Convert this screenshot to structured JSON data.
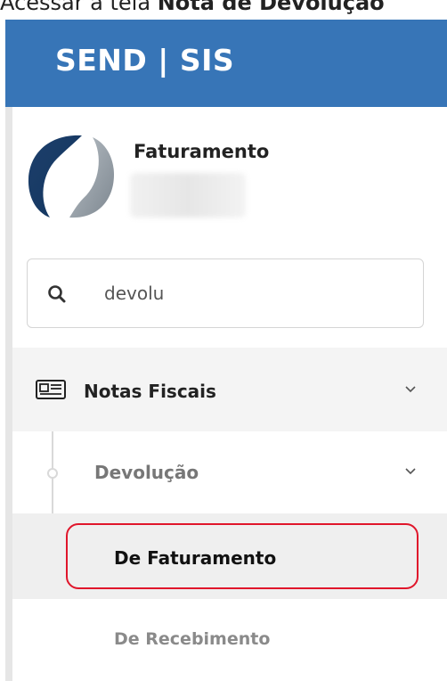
{
  "caption": {
    "prefix": "Acessar a tela ",
    "bold": "Nota de Devolução"
  },
  "header": {
    "brand": "SEND | SIS",
    "color": "#3775b7"
  },
  "profile": {
    "app_name": "Faturamento",
    "logo_icon": "sendsis-logo-icon"
  },
  "search": {
    "value": "devolu",
    "icon": "search-icon"
  },
  "menu": {
    "notas_fiscais": {
      "label": "Notas Fiscais",
      "icon": "newspaper-icon",
      "expanded": true
    },
    "devolucao": {
      "label": "Devolução",
      "expanded": true
    },
    "de_faturamento": {
      "label": "De Faturamento",
      "active": true
    },
    "de_recebimento": {
      "label": "De Recebimento"
    }
  },
  "highlight_color": "#e0162b"
}
